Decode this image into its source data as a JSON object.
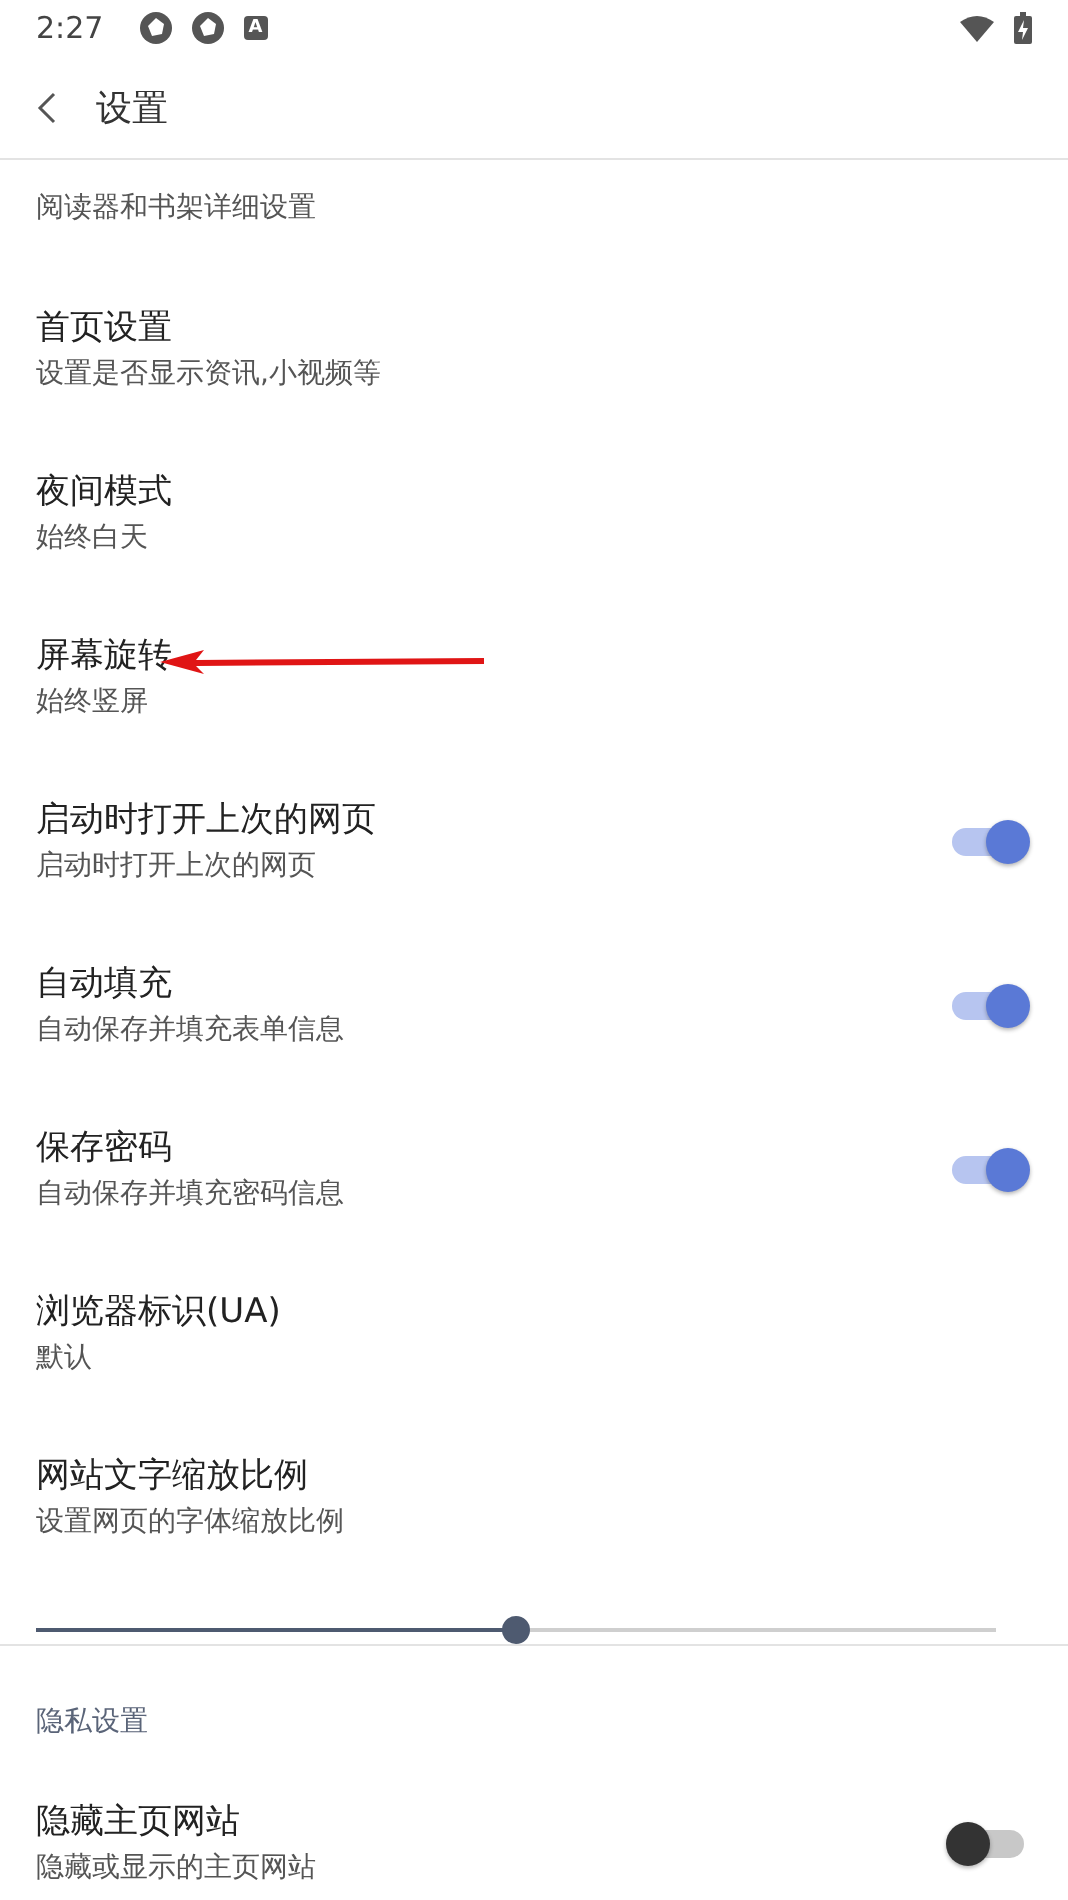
{
  "status_bar": {
    "time": "2:27",
    "app_badge": "A"
  },
  "header": {
    "title": "设置"
  },
  "cut_item": {
    "subtitle": "阅读器和书架详细设置"
  },
  "items": [
    {
      "kind": "nav",
      "title": "首页设置",
      "subtitle": "设置是否显示资讯,小视频等"
    },
    {
      "kind": "nav",
      "title": "夜间模式",
      "subtitle": "始终白天"
    },
    {
      "kind": "nav",
      "title": "屏幕旋转",
      "subtitle": "始终竖屏",
      "annotated": true
    },
    {
      "kind": "toggle",
      "title": "启动时打开上次的网页",
      "subtitle": "启动时打开上次的网页",
      "on": true
    },
    {
      "kind": "toggle",
      "title": "自动填充",
      "subtitle": "自动保存并填充表单信息",
      "on": true
    },
    {
      "kind": "toggle",
      "title": "保存密码",
      "subtitle": "自动保存并填充密码信息",
      "on": true
    },
    {
      "kind": "nav",
      "title": "浏览器标识(UA)",
      "subtitle": "默认"
    },
    {
      "kind": "slider",
      "title": "网站文字缩放比例",
      "subtitle": "设置网页的字体缩放比例",
      "level": 0.5
    }
  ],
  "section": {
    "title": "隐私设置",
    "items": [
      {
        "kind": "toggle",
        "title": "隐藏主页网站",
        "subtitle": "隐藏或显示的主页网站",
        "on": false
      }
    ]
  }
}
